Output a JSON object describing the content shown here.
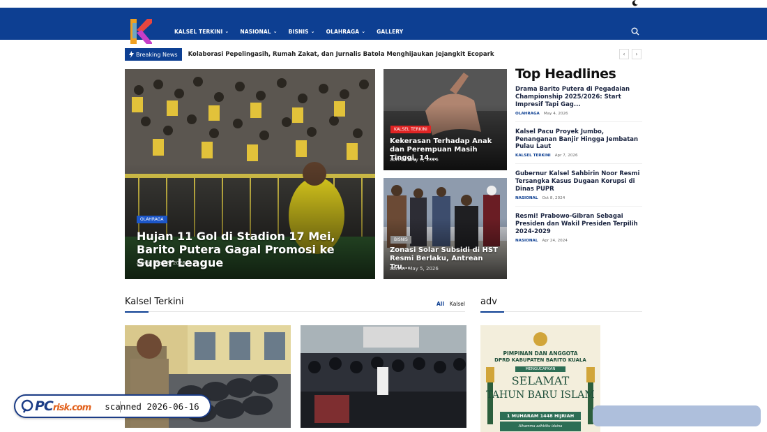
{
  "nav": {
    "items": [
      {
        "label": "KALSEL TERKINI",
        "dropdown": true
      },
      {
        "label": "NASIONAL",
        "dropdown": true
      },
      {
        "label": "BISNIS",
        "dropdown": true
      },
      {
        "label": "OLAHRAGA",
        "dropdown": true
      },
      {
        "label": "GALLERY",
        "dropdown": false
      }
    ]
  },
  "icons": {
    "theme_toggle": "moon-icon",
    "search": "search-icon",
    "breaking": "bolt-icon"
  },
  "colors": {
    "brand": "#0d3f92",
    "badge_red": "#e02424",
    "badge_blue": "#1c56c9"
  },
  "breaking": {
    "label": "Breaking News",
    "headline": "Kolaborasi Pepelingasih, Rumah Zakat, dan Jurnalis Batola Menghijaukan Jejangkit Ecopark",
    "prev": "‹",
    "next": "›"
  },
  "hero": {
    "category": "OLAHRAGA",
    "title": "Hujan 11 Gol di Stadion 17 Mei, Barito Putera Gagal Promosi ke Super League",
    "author": "admin",
    "date": "May 3, 2026"
  },
  "card1": {
    "category": "KALSEL TERKINI",
    "title": "Kekerasan Terhadap Anak dan Perempuan Masih Tinggi, 14...",
    "author": "admin",
    "date": "May 8, 2026"
  },
  "card2": {
    "category": "BISNIS",
    "title": "Zonasi Solar Subsidi di HST Resmi Berlaku, Antrean Tru...",
    "author": "admin",
    "date": "May 5, 2026"
  },
  "headlines": {
    "title": "Top Headlines",
    "items": [
      {
        "title": "Drama Barito Putera di Pegadaian Championship 2025/2026: Start Impresif Tapi Gag...",
        "category": "OLAHRAGA",
        "date": "May 4, 2026"
      },
      {
        "title": "Kalsel Pacu Proyek Jumbo, Penanganan Banjir Hingga Jembatan Pulau Laut",
        "category": "KALSEL TERKINI",
        "date": "Apr 7, 2026"
      },
      {
        "title": "Gubernur Kalsel Sahbirin Noor Resmi Tersangka Kasus Dugaan Korupsi di Dinas PUPR",
        "category": "NASIONAL",
        "date": "Oct 8, 2024"
      },
      {
        "title": "Resmi! Prabowo-Gibran Sebagai Presiden dan Wakil Presiden Terpilih 2024-2029",
        "category": "NASIONAL",
        "date": "Apr 24, 2024"
      }
    ]
  },
  "kalsel_section": {
    "title": "Kalsel Terkini",
    "tabs": [
      "All",
      "Kalsel"
    ]
  },
  "adv_section": {
    "title": "adv",
    "poster": {
      "line1": "PIMPINAN DAN ANGGOTA",
      "line2": "DPRD KABUPATEN BARITO KUALA",
      "line3": "MENGUCAPKAN",
      "line4": "SELAMAT",
      "line5": "TAHUN BARU ISLAM",
      "line6": "1 MUHARAM 1448 HIJRIAH",
      "line7": "Alhamma adhkiltu idaina"
    }
  },
  "watermark": {
    "brand_main": "PC",
    "brand_sub": "risk.com",
    "scan_text": "scanned 2026-06-16"
  }
}
